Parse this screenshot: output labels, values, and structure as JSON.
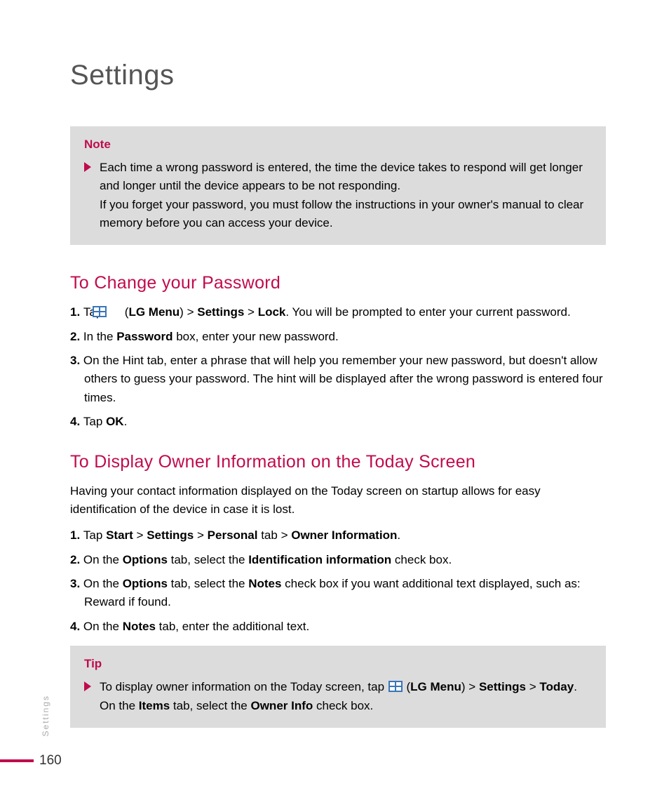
{
  "page_title": "Settings",
  "side_label": "Settings",
  "page_number": "160",
  "note_box": {
    "title": "Note",
    "line1": "Each time a wrong password is entered, the time the device takes to respond will get longer and longer until the device appears to be not responding.",
    "line2": "If you forget your password, you must follow the instructions in your owner's manual to clear memory before you can access your device."
  },
  "section1": {
    "heading": "To Change your Password",
    "step1_pre": "Tap ",
    "step1_b1": "LG Menu",
    "step1_b2": "Settings",
    "step1_b3": "Lock",
    "step1_post": ". You will be prompted to enter your current password.",
    "step2_pre": "In the ",
    "step2_b": "Password",
    "step2_post": " box, enter your new password.",
    "step3": "On the Hint tab, enter a phrase that will help you remember your new password, but doesn't allow others to guess your password. The hint will be displayed after the wrong password is entered four times.",
    "step4_pre": "Tap ",
    "step4_b": "OK",
    "step4_post": "."
  },
  "section2": {
    "heading": "To Display Owner Information on the Today Screen",
    "intro": "Having your contact information displayed on the Today screen on startup allows for easy identification of the device in case it is lost.",
    "step1_pre": "Tap ",
    "step1_b1": "Start",
    "step1_b2": "Settings",
    "step1_b3": "Personal",
    "step1_mid": " tab > ",
    "step1_b4": "Owner Information",
    "step1_post": ".",
    "step2_pre": "On the ",
    "step2_b1": "Options",
    "step2_mid": " tab, select the ",
    "step2_b2": "Identification information",
    "step2_post": " check box.",
    "step3_pre": "On the ",
    "step3_b1": "Options",
    "step3_mid": " tab, select the ",
    "step3_b2": "Notes",
    "step3_post": " check box if you want additional text displayed, such as: Reward if found.",
    "step4_pre": "On the ",
    "step4_b1": "Notes",
    "step4_post": " tab, enter the additional text."
  },
  "tip_box": {
    "title": "Tip",
    "line1_pre": "To display owner information on the Today screen, tap ",
    "line1_b1": "LG Menu",
    "line1_b2": "Settings",
    "line1_b3": "Today",
    "line1_post": ".",
    "line2_pre": "On the ",
    "line2_b1": "Items",
    "line2_mid": " tab, select the ",
    "line2_b2": "Owner Info",
    "line2_post": " check box."
  }
}
